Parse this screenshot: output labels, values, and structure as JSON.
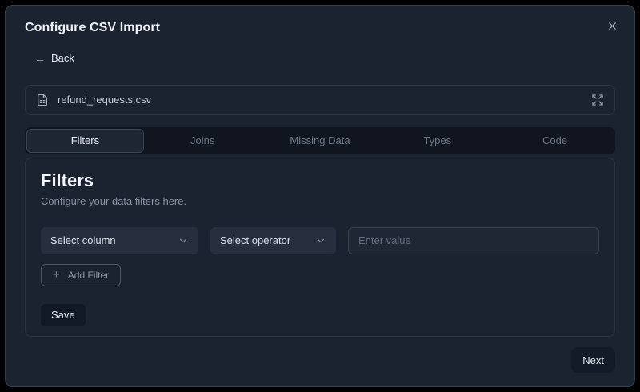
{
  "modal": {
    "title": "Configure CSV Import"
  },
  "back": {
    "arrow": "←",
    "label": "Back"
  },
  "file": {
    "name": "refund_requests.csv"
  },
  "tabs": [
    {
      "label": "Filters",
      "active": true
    },
    {
      "label": "Joins",
      "active": false
    },
    {
      "label": "Missing Data",
      "active": false
    },
    {
      "label": "Types",
      "active": false
    },
    {
      "label": "Code",
      "active": false
    }
  ],
  "panel": {
    "title": "Filters",
    "subtitle": "Configure your data filters here."
  },
  "filter_row": {
    "column_select": "Select column",
    "operator_select": "Select operator",
    "value_placeholder": "Enter value",
    "value_current": ""
  },
  "buttons": {
    "plus": "+",
    "add_filter": "Add Filter",
    "save": "Save",
    "next": "Next"
  },
  "icons": {
    "close": "x-close",
    "back_arrow": "arrow-left",
    "file": "file-text",
    "expand": "expand-arrows",
    "chevron": "chevron-down",
    "plus": "plus"
  },
  "colors": {
    "page_bg": "#000000",
    "modal_bg": "#1b2230",
    "modal_border": "#333b49",
    "tabbar_bg": "#10151f",
    "active_tab_bg": "#1e2633",
    "select_bg": "#272e3d",
    "input_bg": "#1f2634",
    "input_border": "#394150",
    "dark_button_bg": "#131a27",
    "text_primary": "#eef1f6",
    "text_muted": "#8b93a2"
  }
}
